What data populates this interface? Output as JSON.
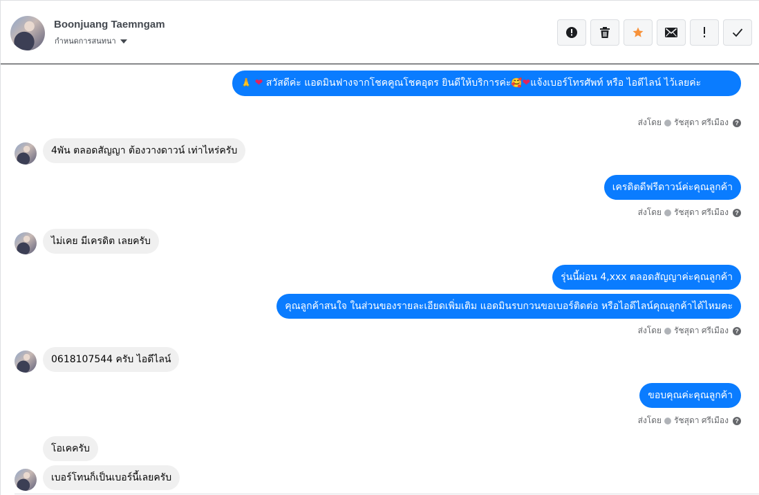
{
  "header": {
    "name": "Boonjuang Taemngam",
    "assign_label": "กำหนดการสนทนา",
    "toolbar": [
      {
        "name": "spam-button",
        "icon": "alert-circle-icon"
      },
      {
        "name": "delete-button",
        "icon": "trash-icon"
      },
      {
        "name": "star-button",
        "icon": "star-icon"
      },
      {
        "name": "mark-unread-button",
        "icon": "envelope-icon"
      },
      {
        "name": "follow-up-button",
        "icon": "exclamation-icon"
      },
      {
        "name": "mark-done-button",
        "icon": "check-icon"
      }
    ]
  },
  "sent_by": {
    "prefix": "ส่งโดย",
    "agent": "รัชสุดา ศรีเมือง"
  },
  "messages": {
    "m1": {
      "prefix_emoji": "🙏",
      "heart": "❤",
      "text1": " สวัสดีค่ะ แอดมินฟางจากโชคคูณโชคอุดร ยินดีให้บริการค่ะ",
      "face_emoji": "🥰",
      "text2": "แจ้งเบอร์โทรศัพท์ หรือ ไอดีไลน์  ไว้เลยค่ะ"
    },
    "m2": {
      "text": "4พัน ตลอดสัญญา ต้องวางดาวน์ เท่าไหร่ครับ"
    },
    "m3": {
      "text": "เครดิตดีฟรีดาวน์ค่ะคุณลูกค้า"
    },
    "m4": {
      "text": "ไม่เคย มีเครดิต เลยครับ"
    },
    "m5": {
      "text": "รุ่นนี้ผ่อน   4,xxx ตลอดสัญญาค่ะคุณลูกค้า"
    },
    "m6": {
      "text": "คุณลูกค้าสนใจ ในส่วนของรายละเอียดเพิ่มเติม แอดมินรบกวนขอเบอร์ติดต่อ หรือไอดีไลน์คุณลูกค้าได้ไหมคะ"
    },
    "m7": {
      "text": "0618107544 ครับ ไอดีไลน์"
    },
    "m8": {
      "text": "ขอบคุณค่ะคุณลูกค้า"
    },
    "m9": {
      "text": "โอเคครับ"
    },
    "m10": {
      "text": "เบอร์โทนก็เป็นเบอร์นี้เลยครับ"
    }
  },
  "colors": {
    "outgoing_bubble": "#0a7cff",
    "incoming_bubble": "#f0f0f0",
    "star_accent": "#f7923a"
  }
}
